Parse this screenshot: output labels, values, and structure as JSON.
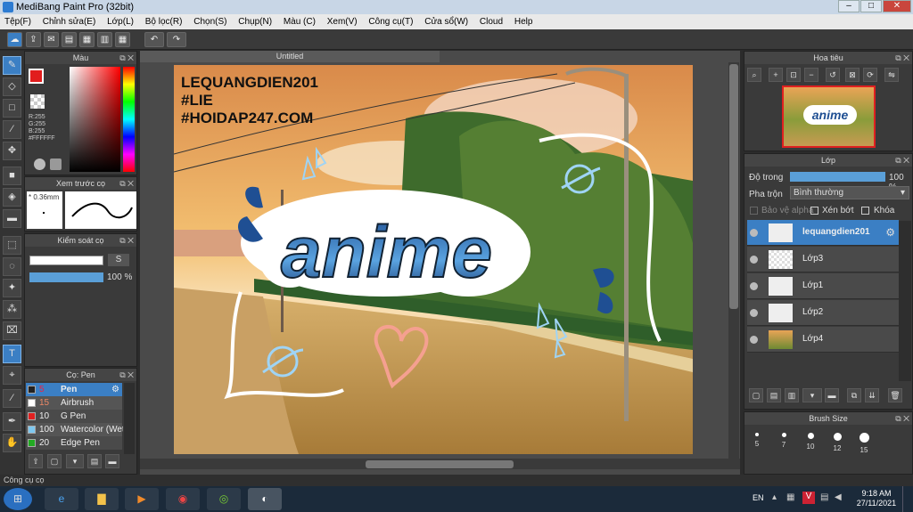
{
  "window": {
    "title": "MediBang Paint Pro (32bit)"
  },
  "menu": [
    "Tệp(F)",
    "Chỉnh sửa(E)",
    "Lớp(L)",
    "Bộ lọc(R)",
    "Chọn(S)",
    "Chụp(N)",
    "Màu (C)",
    "Xem(V)",
    "Công cụ(T)",
    "Cửa sổ(W)",
    "Cloud",
    "Help"
  ],
  "color_panel": {
    "title": "Màu",
    "rgb": [
      "R:255",
      "G:255",
      "B:255"
    ],
    "hex": "#FFFFFF",
    "primary": "#e11d1d"
  },
  "brush_preview": {
    "title": "Xem trước cọ",
    "size": "0.36mm"
  },
  "brush_control": {
    "title": "Kiểm soát cọ",
    "size_btn": "S",
    "opacity": "100 %"
  },
  "brush_panel": {
    "title": "Cọ: Pen",
    "items": [
      {
        "size": "5",
        "name": "Pen",
        "color": "#222222"
      },
      {
        "size": "15",
        "name": "Airbrush",
        "color": "#ffffff"
      },
      {
        "size": "10",
        "name": "G Pen",
        "color": "#e02020"
      },
      {
        "size": "100",
        "name": "Watercolor (Wet",
        "color": "#7ec8f0"
      },
      {
        "size": "20",
        "name": "Edge Pen",
        "color": "#22aa22"
      }
    ]
  },
  "document": {
    "tab": "Untitled"
  },
  "artwork": {
    "text_lines": [
      "LEQUANGDIEN201",
      "#LIE",
      "#HOIDAP247.COM"
    ],
    "logo": "anime"
  },
  "navigator": {
    "title": "Hoa tiêu"
  },
  "layer_panel": {
    "title": "Lớp",
    "opacity_label": "Độ trong",
    "opacity_value": "100 %",
    "blend_label": "Pha trộn",
    "blend_value": "Bình thường",
    "alpha_lock": "Bảo vệ alpha",
    "clip": "Xén bớt",
    "lock": "Khóa",
    "layers": [
      {
        "name": "lequangdien201",
        "selected": true
      },
      {
        "name": "Lớp3",
        "selected": false
      },
      {
        "name": "Lớp1",
        "selected": false
      },
      {
        "name": "Lớp2",
        "selected": false
      },
      {
        "name": "Lớp4",
        "selected": false
      }
    ]
  },
  "brush_size": {
    "title": "Brush Size",
    "sizes": [
      "5",
      "7",
      "10",
      "12",
      "15"
    ]
  },
  "status": {
    "text": "Công cụ cọ"
  },
  "taskbar": {
    "lang": "EN",
    "time": "9:18 AM",
    "date": "27/11/2021"
  }
}
